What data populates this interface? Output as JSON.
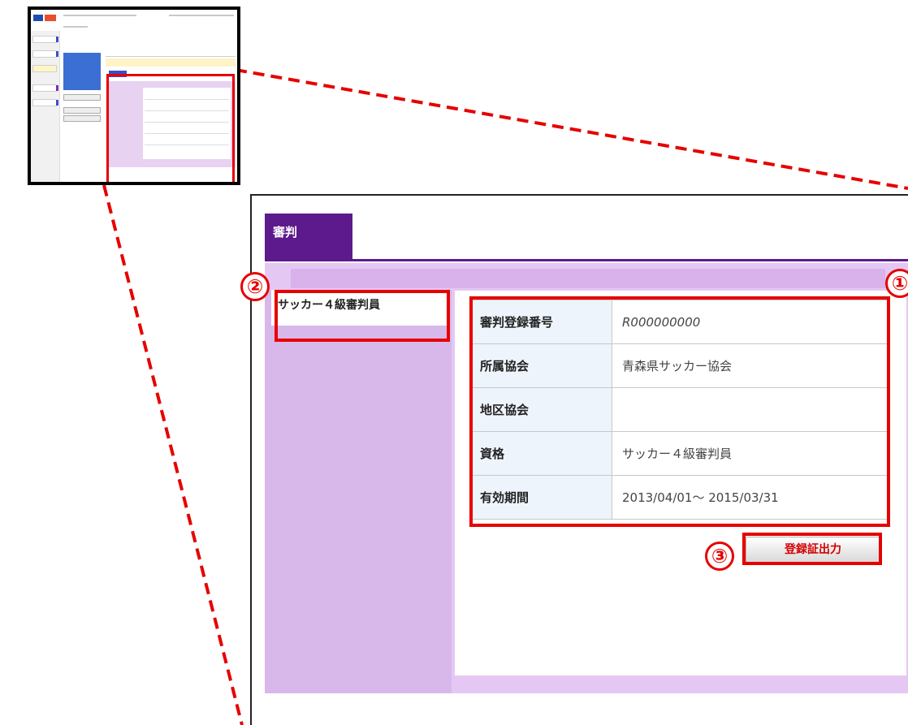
{
  "panel": {
    "tab_label": "審判",
    "side_item": "サッカー４級審判員",
    "rows": [
      {
        "label": "審判登録番号",
        "value": "R000000000"
      },
      {
        "label": "所属協会",
        "value": "青森県サッカー協会"
      },
      {
        "label": "地区協会",
        "value": ""
      },
      {
        "label": "資格",
        "value": "サッカー４級審判員"
      },
      {
        "label": "有効期間",
        "value": "2013/04/01～ 2015/03/31"
      }
    ],
    "print_button": "登録証出力"
  },
  "callouts": [
    "①",
    "②",
    "③"
  ],
  "colors": {
    "accent_purple": "#5c1a8c",
    "highlight_red": "#e60000",
    "panel_bg": "#e5c7f4"
  }
}
